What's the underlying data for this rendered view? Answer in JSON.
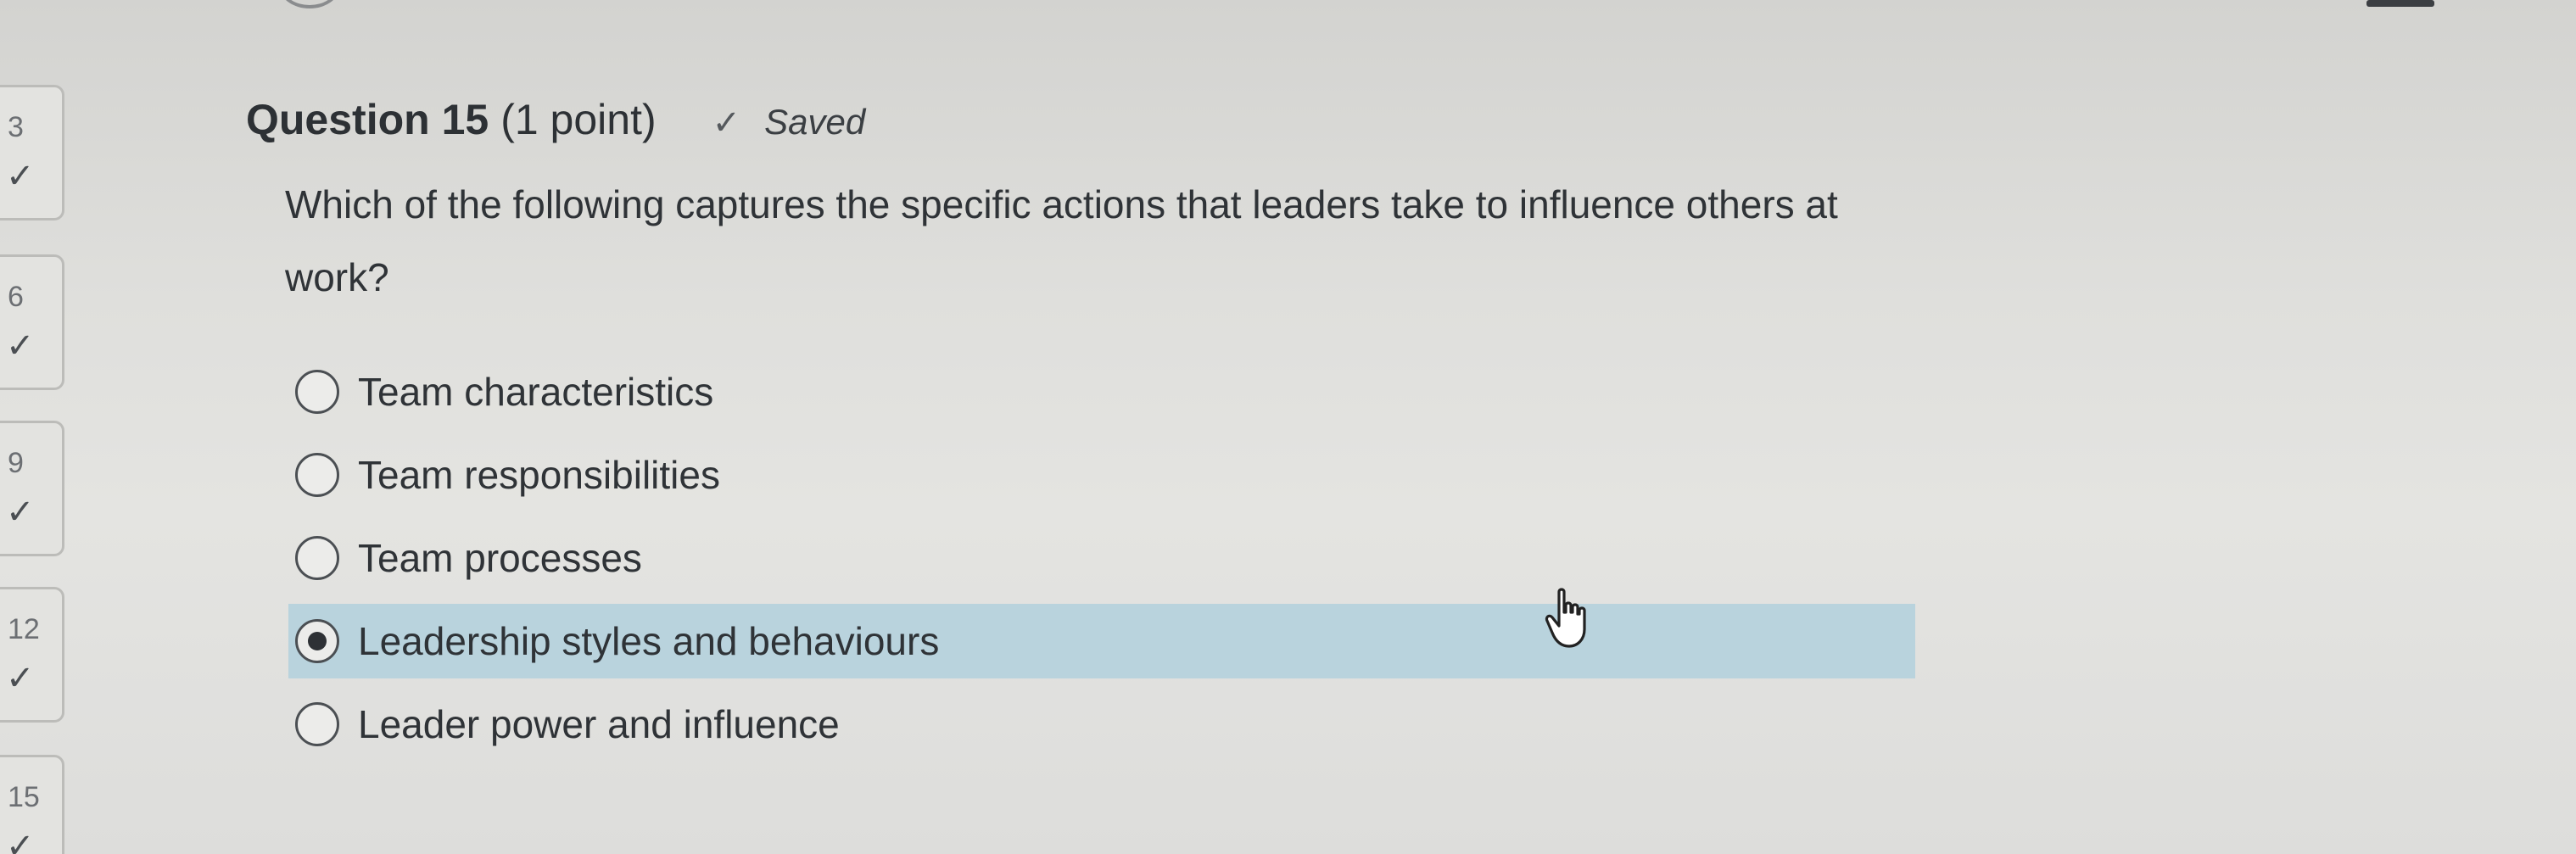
{
  "nav": {
    "items": [
      {
        "number": "3",
        "status": "answered"
      },
      {
        "number": "6",
        "status": "answered"
      },
      {
        "number": "9",
        "status": "answered"
      },
      {
        "number": "12",
        "status": "answered"
      },
      {
        "number": "15",
        "status": "answered"
      }
    ],
    "check_glyph": "✓"
  },
  "question": {
    "title": "Question 15",
    "points": "(1 point)",
    "saved_icon": "check-icon",
    "saved_glyph": "✓",
    "saved_label": "Saved",
    "text": "Which of the following captures the specific actions that leaders take to influence others at work?",
    "options": [
      {
        "label": "Team characteristics",
        "selected": false
      },
      {
        "label": "Team responsibilities",
        "selected": false
      },
      {
        "label": "Team processes",
        "selected": false
      },
      {
        "label": "Leadership styles and behaviours",
        "selected": true
      },
      {
        "label": "Leader power and influence",
        "selected": false
      }
    ]
  },
  "colors": {
    "selected_highlight": "#b9d3dd",
    "text": "#2f3337"
  }
}
